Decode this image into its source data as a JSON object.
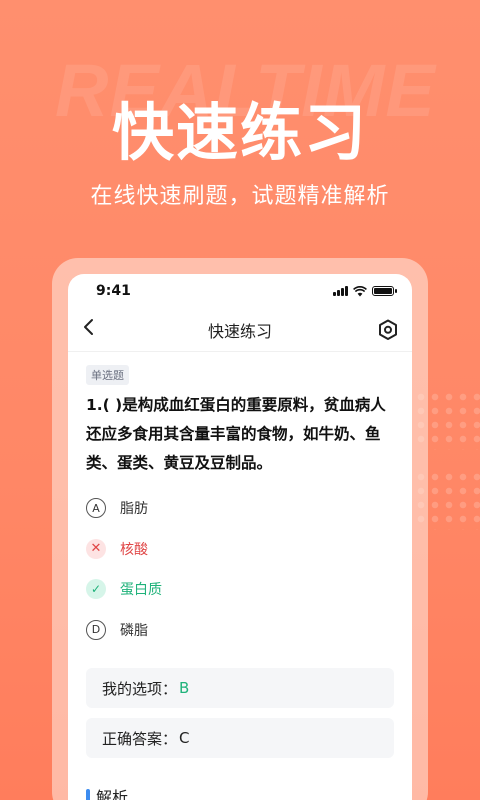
{
  "hero": {
    "watermark": "REALTIME",
    "title": "快速练习",
    "subtitle": "在线快速刷题，试题精准解析"
  },
  "status_bar": {
    "time": "9:41"
  },
  "navbar": {
    "title": "快速练习",
    "back_icon": "chevron-left-icon",
    "settings_icon": "hexagon-settings-icon"
  },
  "question": {
    "type_badge": "单选题",
    "text": "1.( )是构成血红蛋白的重要原料，贫血病人还应多食用其含量丰富的食物，如牛奶、鱼类、蛋类、黄豆及豆制品。",
    "options": [
      {
        "marker": "A",
        "text": "脂肪",
        "state": "normal"
      },
      {
        "marker": "✕",
        "text": "核酸",
        "state": "wrong"
      },
      {
        "marker": "✓",
        "text": "蛋白质",
        "state": "right"
      },
      {
        "marker": "D",
        "text": "磷脂",
        "state": "normal"
      }
    ]
  },
  "result": {
    "my_choice_label": "我的选项：",
    "my_choice_value": "B",
    "correct_label": "正确答案：",
    "correct_value": "C"
  },
  "analysis": {
    "label": "解析"
  },
  "colors": {
    "background": "#ff8766",
    "wrong": "#e04646",
    "right": "#1fb27a",
    "accent_bar": "#3c8cf0"
  }
}
